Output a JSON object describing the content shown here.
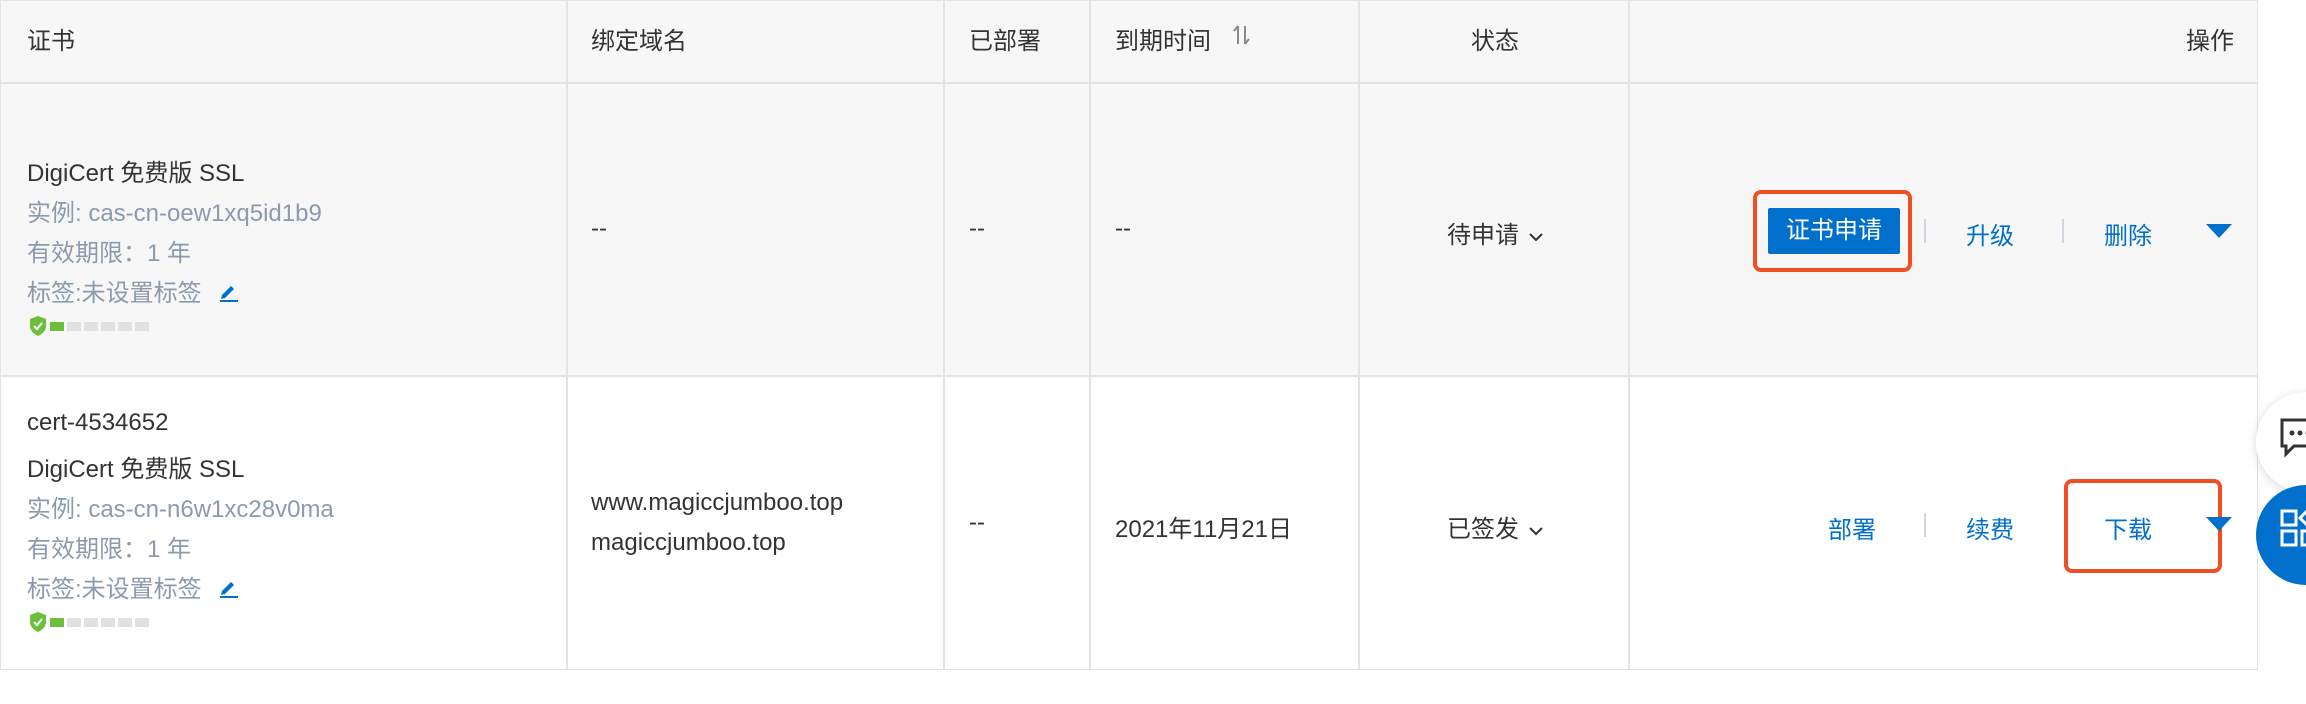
{
  "colors": {
    "accent": "#0070cc",
    "highlight": "#f24e23",
    "ok": "#6bbf3a"
  },
  "header": {
    "cert": "证书",
    "domain": "绑定域名",
    "deployed": "已部署",
    "expiry": "到期时间",
    "status": "状态",
    "actions": "操作"
  },
  "rows": [
    {
      "name_line1": "DigiCert 免费版 SSL",
      "instance": "实例: cas-cn-oew1xq5id1b9",
      "validity": "有效期限：1 年",
      "tag": "标签:未设置标签",
      "domain": "--",
      "deployed": "--",
      "expiry": "--",
      "status": "待申请",
      "actions": [
        "证书申请",
        "升级",
        "删除"
      ],
      "security_level": 1
    },
    {
      "cert_id": "cert-4534652",
      "name_line1": "DigiCert 免费版 SSL",
      "instance": "实例: cas-cn-n6w1xc28v0ma",
      "validity": "有效期限：1 年",
      "tag": "标签:未设置标签",
      "domain_1": "www.magiccjumboo.top",
      "domain_2": "magiccjumboo.top",
      "deployed": "--",
      "expiry": "2021年11月21日",
      "status": "已签发",
      "actions": [
        "部署",
        "续费",
        "下载"
      ],
      "security_level": 1
    }
  ]
}
